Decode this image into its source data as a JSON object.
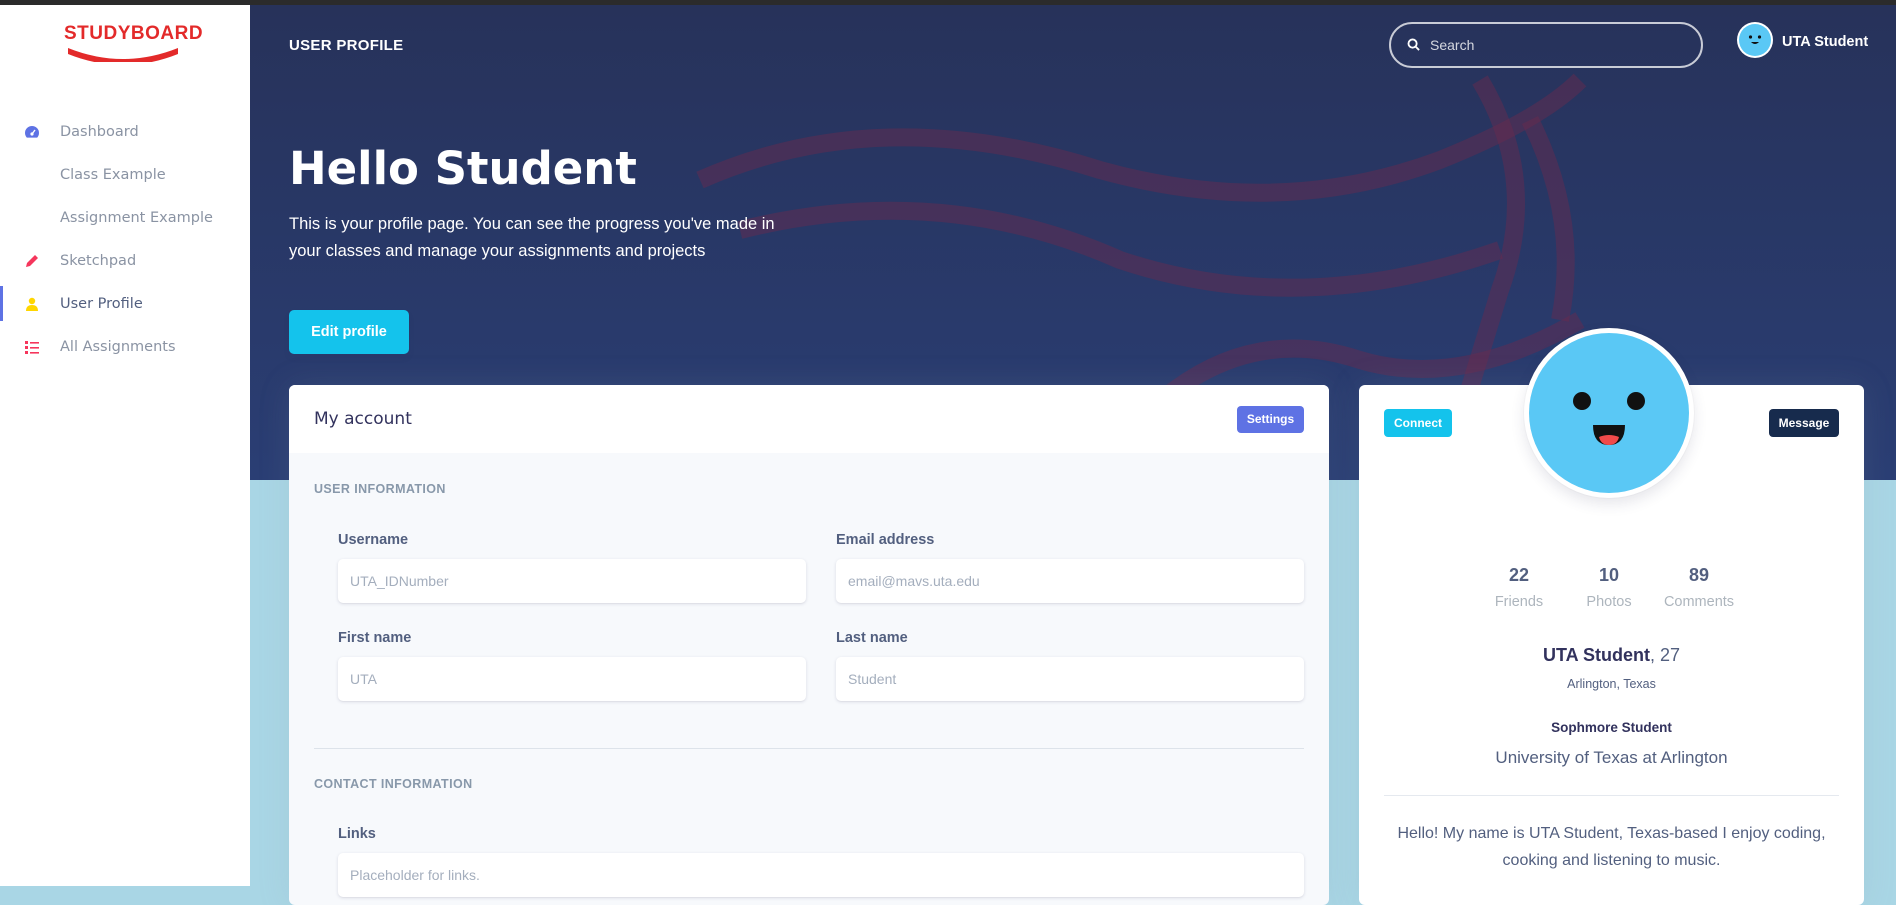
{
  "app": {
    "logo_text": "STUDYBOARD"
  },
  "sidebar": {
    "items": [
      {
        "label": "Dashboard",
        "icon": "dashboard-gauge-icon",
        "color": "#5e72e4",
        "active": false
      },
      {
        "label": "Class Example",
        "icon": "",
        "active": false
      },
      {
        "label": "Assignment Example",
        "icon": "",
        "active": false
      },
      {
        "label": "Sketchpad",
        "icon": "pencil-icon",
        "color": "#f5365c",
        "active": false
      },
      {
        "label": "User Profile",
        "icon": "user-icon",
        "color": "#ffd600",
        "active": true
      },
      {
        "label": "All Assignments",
        "icon": "list-icon",
        "color": "#f5365c",
        "active": false
      }
    ]
  },
  "header": {
    "page_label": "USER PROFILE",
    "search_placeholder": "Search",
    "user_name": "UTA Student"
  },
  "hero": {
    "title": "Hello Student",
    "text": "This is your profile page. You can see the progress you've made in your classes and manage your assignments and projects",
    "edit_button": "Edit profile"
  },
  "account": {
    "title": "My account",
    "settings_button": "Settings",
    "user_info_title": "USER INFORMATION",
    "username_label": "Username",
    "username_placeholder": "UTA_IDNumber",
    "email_label": "Email address",
    "email_placeholder": "email@mavs.uta.edu",
    "first_name_label": "First name",
    "first_name_placeholder": "UTA",
    "last_name_label": "Last name",
    "last_name_placeholder": "Student",
    "contact_info_title": "CONTACT INFORMATION",
    "links_label": "Links",
    "links_placeholder": "Placeholder for links."
  },
  "profile": {
    "connect_button": "Connect",
    "message_button": "Message",
    "stats": [
      {
        "value": "22",
        "label": "Friends"
      },
      {
        "value": "10",
        "label": "Photos"
      },
      {
        "value": "89",
        "label": "Comments"
      }
    ],
    "name": "UTA Student",
    "age": ", 27",
    "location": "Arlington, Texas",
    "year": "Sophmore Student",
    "school": "University of Texas at Arlington",
    "bio": "Hello! My name is UTA Student, Texas-based I enjoy coding, cooking and listening to music."
  },
  "colors": {
    "primary": "#5e72e4",
    "info": "#14c3ec",
    "dark": "#172b4d",
    "hero": "#27325a",
    "avatar": "#5ac8f5"
  }
}
